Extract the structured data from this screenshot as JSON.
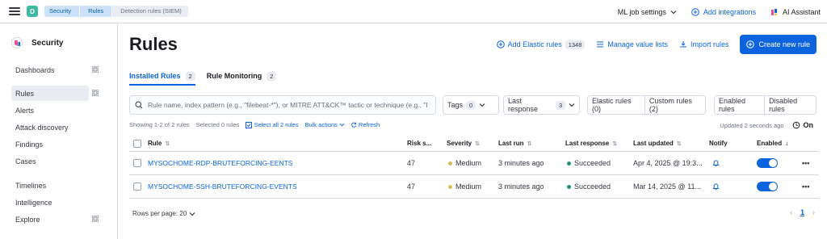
{
  "topbar": {
    "space_initial": "D",
    "breadcrumbs": [
      "Security",
      "Rules",
      "Detection rules (SIEM)"
    ],
    "ml_job_settings": "ML job settings",
    "add_integrations": "Add integrations",
    "ai_assistant": "AI Assistant"
  },
  "sidebar": {
    "title": "Security",
    "items": [
      {
        "label": "Dashboards"
      },
      {
        "label": "Rules"
      },
      {
        "label": "Alerts"
      },
      {
        "label": "Attack discovery"
      },
      {
        "label": "Findings"
      },
      {
        "label": "Cases"
      },
      {
        "label": "Timelines"
      },
      {
        "label": "Intelligence"
      },
      {
        "label": "Explore"
      }
    ]
  },
  "page": {
    "title": "Rules",
    "add_elastic_rules": "Add Elastic rules",
    "add_elastic_rules_count": "1348",
    "manage_value_lists": "Manage value lists",
    "import_rules": "Import rules",
    "create_new_rule": "Create new rule"
  },
  "tabs": [
    {
      "label": "Installed Rules",
      "count": "2"
    },
    {
      "label": "Rule Monitoring",
      "count": "2"
    }
  ],
  "filters": {
    "search_placeholder": "Rule name, index pattern (e.g., \"filebeat-*\"), or MITRE ATT&CK™ tactic or technique (e.g., \"I",
    "tags_label": "Tags",
    "tags_count": "0",
    "last_response_label": "Last response",
    "last_response_count": "3",
    "elastic_rules": "Elastic rules (0)",
    "custom_rules": "Custom rules (2)",
    "enabled_rules": "Enabled rules",
    "disabled_rules": "Disabled rules"
  },
  "utility": {
    "showing": "Showing 1-2 of 2 rules",
    "selected": "Selected 0 rules",
    "select_all": "Select all 2 rules",
    "bulk_actions": "Bulk actions",
    "refresh": "Refresh",
    "updated": "Updated 2 seconds ago",
    "on_label": "On"
  },
  "table": {
    "columns": [
      "Rule",
      "Risk s...",
      "Severity",
      "Last run",
      "Last response",
      "Last updated",
      "Notify",
      "Enabled"
    ],
    "rows": [
      {
        "rule": "MYSOCHOME-RDP-BRUTEFORCING-EENTS",
        "risk": "47",
        "severity": "Medium",
        "last_run": "3 minutes ago",
        "last_response": "Succeeded",
        "last_updated": "Apr 4, 2025 @ 19:3..."
      },
      {
        "rule": "MYSOCHOME-SSH-BRUTEFORCING-EVENTS",
        "risk": "47",
        "severity": "Medium",
        "last_run": "3 minutes ago",
        "last_response": "Succeeded",
        "last_updated": "Mar 14, 2025 @ 11..."
      }
    ]
  },
  "footer": {
    "rows_per_page": "Rows per page: 20",
    "current_page": "1"
  },
  "colors": {
    "accent": "#0b64dd",
    "severity_medium": "#d6bf57",
    "success": "#209280"
  }
}
